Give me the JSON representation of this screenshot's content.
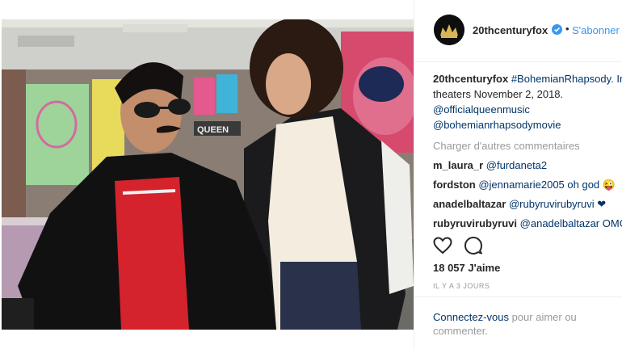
{
  "post": {
    "account": "20thcenturyfox",
    "follow_label": "S'abonner",
    "dot": "•",
    "avatar_icon": "fox-studio-logo-icon",
    "caption": {
      "username": "20thcenturyfox",
      "line1": "#BohemianRhapsody. In",
      "line2": "theaters November 2, 2018.",
      "line3": "@officialqueenmusic",
      "line4": "@bohemianrhapsodymovie"
    },
    "load_more": "Charger d'autres commentaires",
    "comments": [
      {
        "user": "m_laura_r",
        "text": "@furdaneta2"
      },
      {
        "user": "fordston",
        "text": "@jennamarie2005 oh god 😜"
      },
      {
        "user": "anadelbaltazar",
        "text": "@rubyruvirubyruvi ❤"
      },
      {
        "user": "rubyruvirubyruvi",
        "text": "@anadelbaltazar OMG"
      }
    ],
    "likes": "18 057 J'aime",
    "time_ago": "IL Y A 3 JOURS",
    "login_link": "Connectez-vous",
    "login_rest": "pour aimer ou commenter."
  },
  "photo": {
    "poster_text": "QUEEN"
  },
  "colors": {
    "accent_blue": "#3897f0",
    "link_dark_blue": "#003569",
    "muted": "#999999",
    "text": "#262626"
  }
}
